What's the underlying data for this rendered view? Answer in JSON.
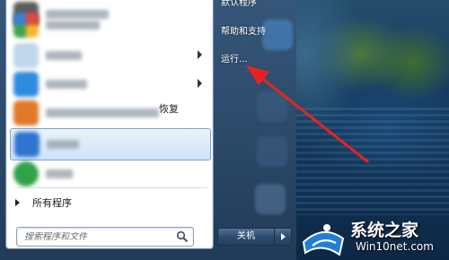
{
  "start_menu": {
    "recent_program_fragment": "恢复",
    "all_programs_label": "所有程序",
    "search_placeholder": "搜索程序和文件",
    "right_items": {
      "default_programs": "默认程序",
      "help_support": "帮助和支持",
      "run": "运行..."
    },
    "shutdown_label": "关机"
  },
  "watermark": {
    "title": "系统之家",
    "url": "Win10net.com"
  },
  "colors": {
    "annotation_arrow": "#e8231f",
    "menu_background": "#2a4766",
    "highlight": "#cfe3f7"
  }
}
